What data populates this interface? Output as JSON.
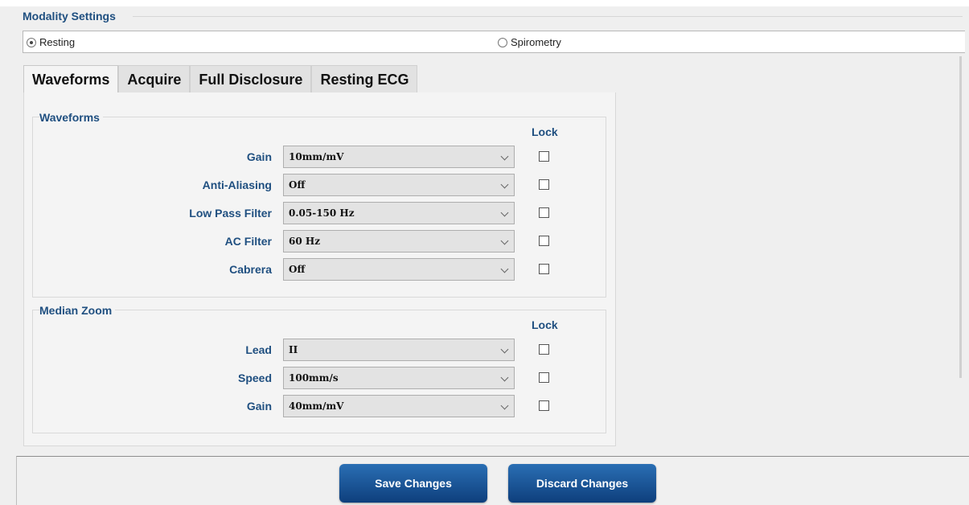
{
  "modality": {
    "title": "Modality Settings",
    "options": [
      {
        "label": "Resting",
        "checked": true
      },
      {
        "label": "Spirometry",
        "checked": false
      }
    ]
  },
  "tabs": [
    {
      "label": "Waveforms",
      "active": true
    },
    {
      "label": "Acquire",
      "active": false
    },
    {
      "label": "Full Disclosure",
      "active": false
    },
    {
      "label": "Resting ECG",
      "active": false
    }
  ],
  "waveforms": {
    "title": "Waveforms",
    "lock_label": "Lock",
    "rows": [
      {
        "label": "Gain",
        "value": "10mm/mV",
        "locked": false
      },
      {
        "label": "Anti-Aliasing",
        "value": "Off",
        "locked": false
      },
      {
        "label": "Low Pass Filter",
        "value": "0.05-150 Hz",
        "locked": false
      },
      {
        "label": "AC Filter",
        "value": "60 Hz",
        "locked": false
      },
      {
        "label": "Cabrera",
        "value": "Off",
        "locked": false
      }
    ]
  },
  "median_zoom": {
    "title": "Median Zoom",
    "lock_label": "Lock",
    "rows": [
      {
        "label": "Lead",
        "value": "II",
        "locked": false
      },
      {
        "label": "Speed",
        "value": "100mm/s",
        "locked": false
      },
      {
        "label": "Gain",
        "value": "40mm/mV",
        "locked": false
      }
    ]
  },
  "footer": {
    "save_label": "Save Changes",
    "discard_label": "Discard Changes"
  },
  "colors": {
    "label_blue": "#1f4f80",
    "button_top": "#2a6fb4",
    "button_bottom": "#0e3f7c"
  }
}
